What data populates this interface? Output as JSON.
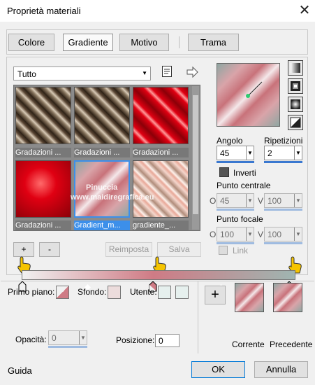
{
  "window": {
    "title": "Proprietà materiali"
  },
  "tabs": [
    {
      "label": "Colore"
    },
    {
      "label": "Gradiente"
    },
    {
      "label": "Motivo"
    },
    {
      "label": "Trama"
    }
  ],
  "category": {
    "value": "Tutto"
  },
  "gradients": [
    {
      "label": "Gradazioni ..."
    },
    {
      "label": "Gradazioni ..."
    },
    {
      "label": "Gradazioni ..."
    },
    {
      "label": "Gradazioni ..."
    },
    {
      "label": "Gradient_m...",
      "selected": true
    },
    {
      "label": "gradiente_..."
    }
  ],
  "watermark": {
    "line1": "Pinuccia",
    "line2": "www.maidiregrafica.eu"
  },
  "list_buttons": {
    "add": "+",
    "remove": "-",
    "reset": "Reimposta",
    "save": "Salva"
  },
  "angle": {
    "label": "Angolo",
    "value": "45"
  },
  "repeats": {
    "label": "Ripetizioni",
    "value": "2"
  },
  "invert": {
    "label": "Inverti"
  },
  "center_point": {
    "label": "Punto centrale",
    "o_label": "O",
    "o_value": "45",
    "v_label": "V",
    "v_value": "100"
  },
  "focal_point": {
    "label": "Punto focale",
    "o_label": "O",
    "o_value": "100",
    "v_label": "V",
    "v_value": "100"
  },
  "link": {
    "label": "Link"
  },
  "bottom": {
    "foreground_label": "Primo piano:",
    "background_label": "Sfondo:",
    "user_label": "Utente:",
    "opacity_label": "Opacità:",
    "opacity_value": "0",
    "position_label": "Posizione:",
    "position_value": "0",
    "current_label": "Corrente",
    "previous_label": "Precedente",
    "plus": "+"
  },
  "footer": {
    "help": "Guida",
    "ok": "OK",
    "cancel": "Annulla"
  },
  "colors": {
    "accent": "#3a78d0",
    "pink": "#cf7b85",
    "sage": "#9fb5b1",
    "red": "#e00012",
    "brown": "#6e5a46"
  }
}
